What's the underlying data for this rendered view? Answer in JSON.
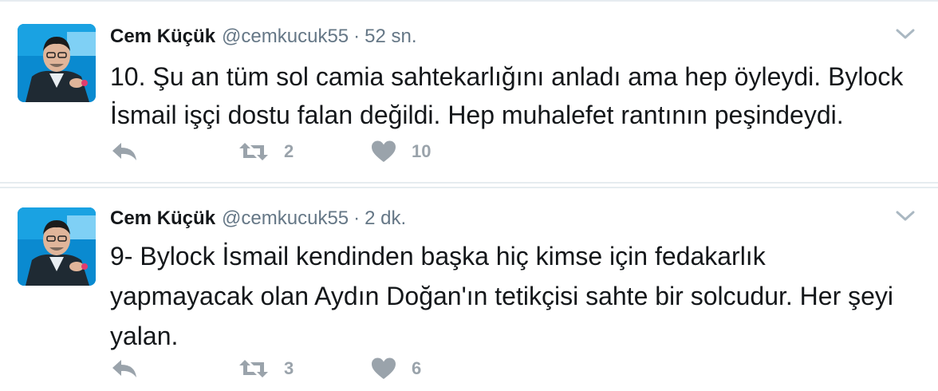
{
  "tweets": [
    {
      "author_name": "Cem Küçük",
      "handle": "@cemkucuk55",
      "separator": "·",
      "time": "52 sn.",
      "text": "10. Şu an tüm sol camia sahtekarlığını anladı ama hep öyleydi. Bylock\nİsmail işçi dostu falan değildi. Hep muhalefet rantının peşindeydi.",
      "retweet_count": "2",
      "like_count": "10"
    },
    {
      "author_name": "Cem Küçük",
      "handle": "@cemkucuk55",
      "separator": "·",
      "time": "2 dk.",
      "text": "9- Bylock İsmail kendinden başka hiç kimse için fedakarlık\nyapmayacak olan Aydın Doğan'ın tetikçisi sahte bir solcudur. Her şeyi\nyalan.",
      "retweet_count": "3",
      "like_count": "6"
    }
  ],
  "icons": {
    "reply": "reply-icon",
    "retweet": "retweet-icon",
    "like": "heart-icon",
    "menu": "chevron-down-icon"
  },
  "colors": {
    "text": "#14171a",
    "secondary": "#657786",
    "action": "#9aa3ab",
    "divider": "#e6ecf0"
  }
}
